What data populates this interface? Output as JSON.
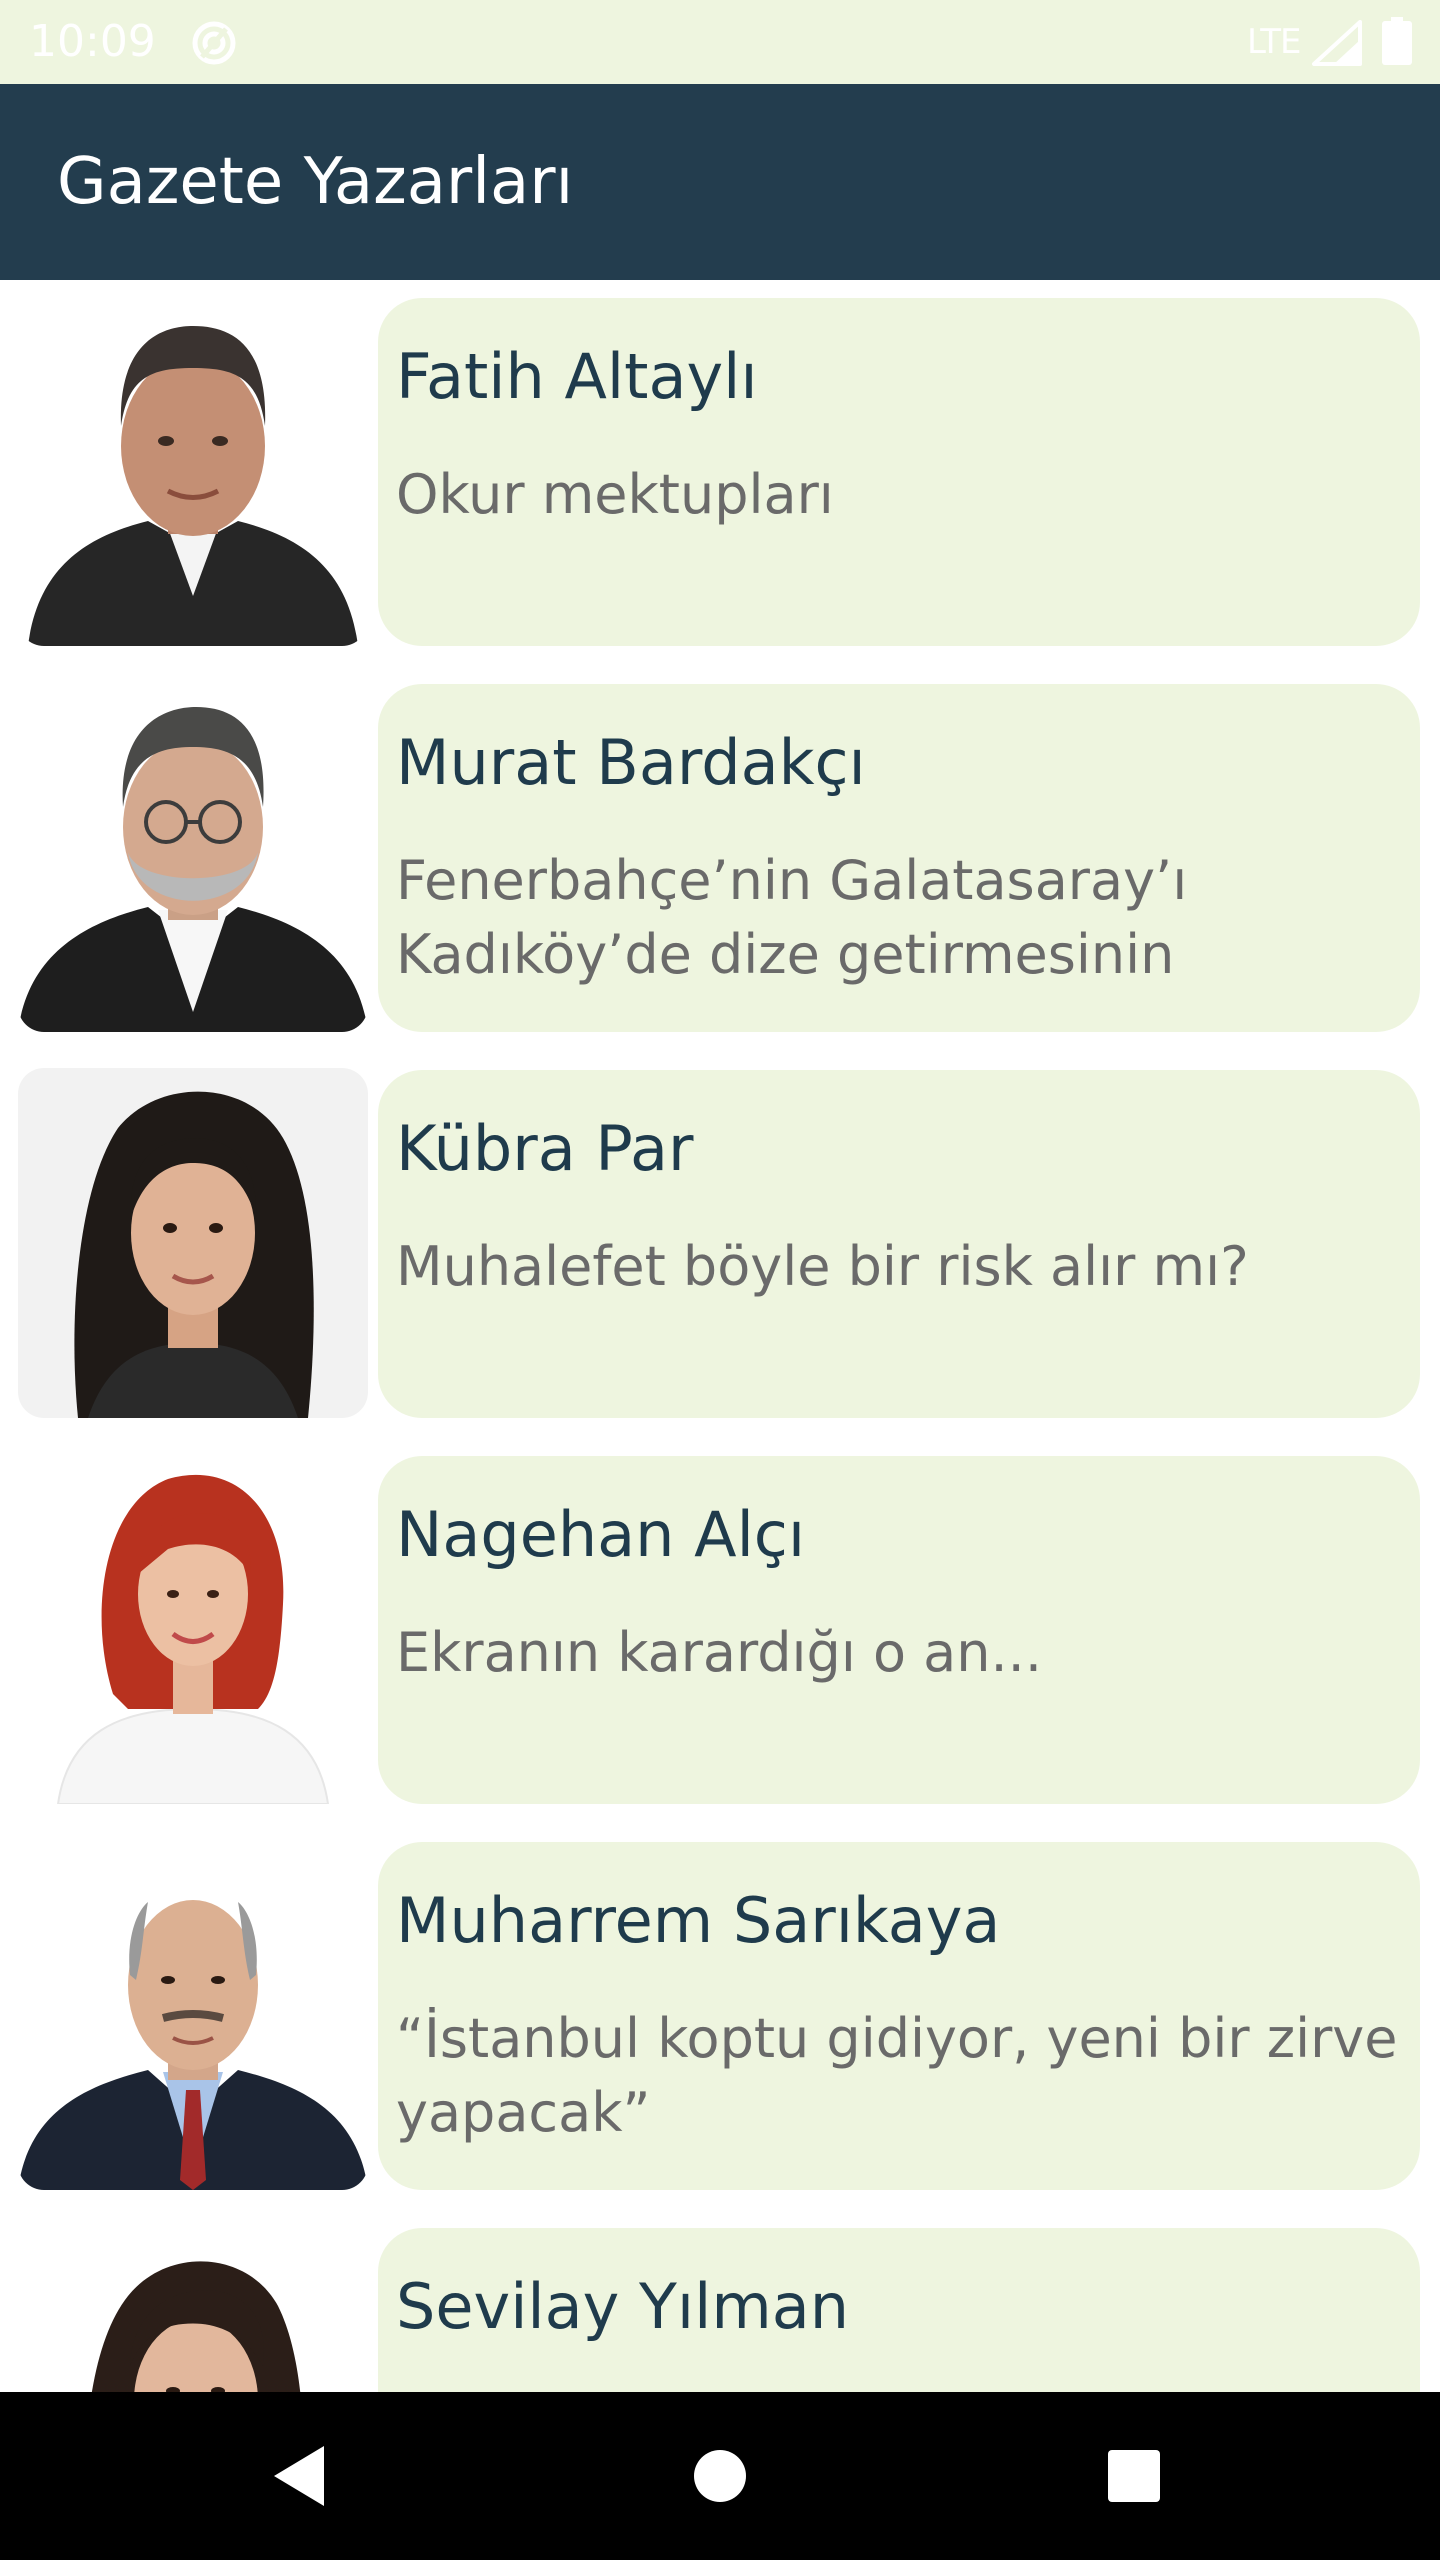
{
  "status_bar": {
    "time": "10:09",
    "network": "LTE",
    "icons": [
      "sync-icon",
      "signal-icon",
      "battery-icon"
    ]
  },
  "app_bar": {
    "title": "Gazete Yazarları",
    "color": "#233d4e"
  },
  "authors": [
    {
      "name": "Fatih Altaylı",
      "article": "Okur mektupları",
      "avatar": "portrait-photo"
    },
    {
      "name": "Murat Bardakçı",
      "article": "Fenerbahçe’nin Galatasaray’ı Kadıköy’de dize getirmesinin",
      "avatar": "portrait-photo"
    },
    {
      "name": "Kübra Par",
      "article": "Muhalefet böyle bir risk alır mı?",
      "avatar": "portrait-photo"
    },
    {
      "name": "Nagehan Alçı",
      "article": "Ekranın karardığı o an...",
      "avatar": "portrait-photo"
    },
    {
      "name": "Muharrem Sarıkaya",
      "article": "“İstanbul koptu gidiyor, yeni bir zirve yapacak”",
      "avatar": "portrait-photo"
    },
    {
      "name": "Sevilay Yılman",
      "article": "",
      "avatar": "portrait-photo"
    }
  ],
  "colors": {
    "card_background": "#eef5df",
    "name_text": "#1f3b4c",
    "article_text": "#6a6a6a"
  },
  "nav_bar": {
    "buttons": [
      "back-icon",
      "home-icon",
      "recents-icon"
    ]
  }
}
